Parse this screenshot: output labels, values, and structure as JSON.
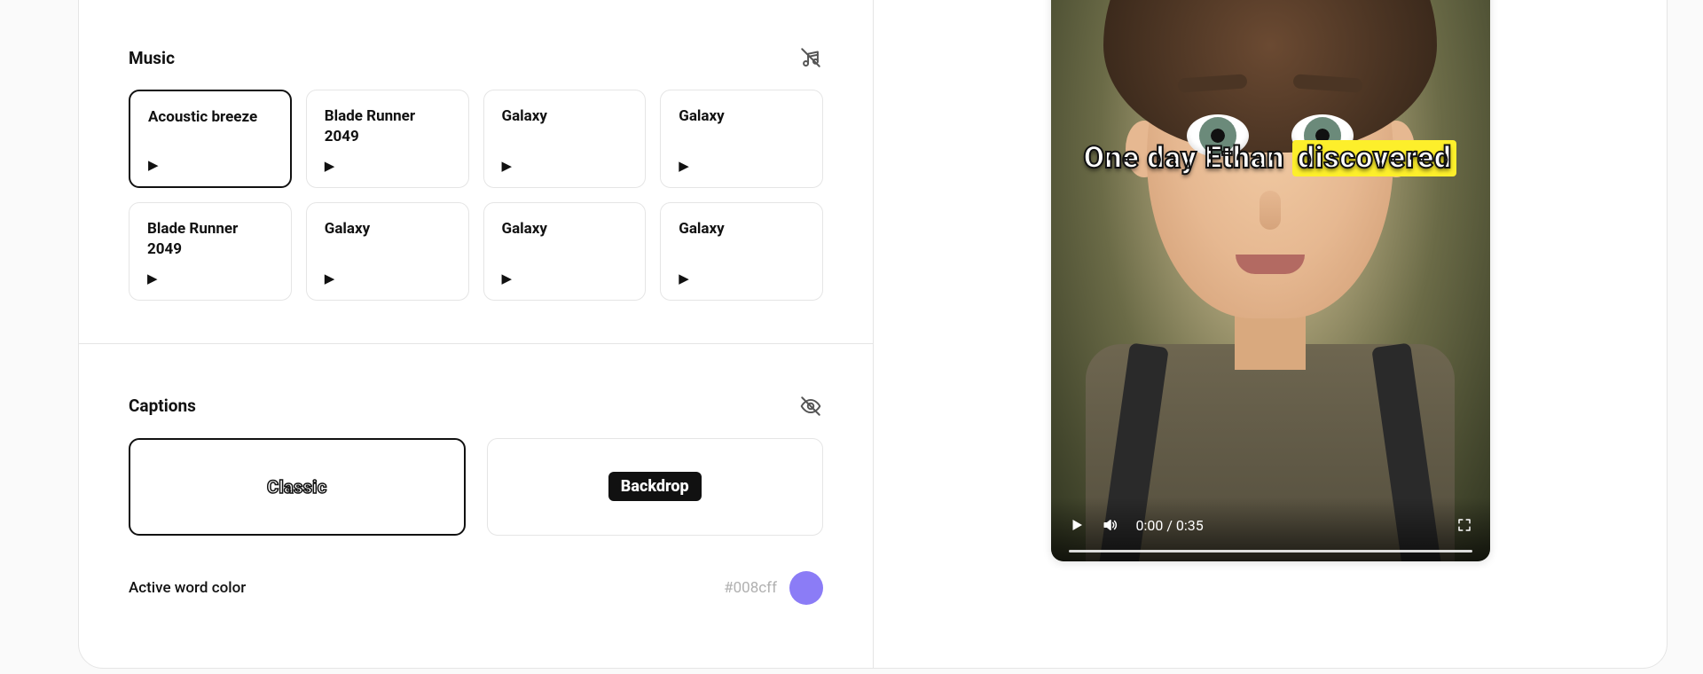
{
  "music": {
    "title": "Music",
    "tracks": [
      {
        "name": "Acoustic breeze",
        "selected": true
      },
      {
        "name": "Blade Runner 2049",
        "selected": false
      },
      {
        "name": "Galaxy",
        "selected": false
      },
      {
        "name": "Galaxy",
        "selected": false
      },
      {
        "name": "Blade Runner 2049",
        "selected": false
      },
      {
        "name": "Galaxy",
        "selected": false
      },
      {
        "name": "Galaxy",
        "selected": false
      },
      {
        "name": "Galaxy",
        "selected": false
      }
    ]
  },
  "captions": {
    "title": "Captions",
    "styles": [
      {
        "name": "Classic",
        "selected": true
      },
      {
        "name": "Backdrop",
        "selected": false
      }
    ],
    "active_word_color_label": "Active word color",
    "active_word_color_hex": "#008cff"
  },
  "preview": {
    "subtitle_plain": "One day Ethan",
    "subtitle_highlight": "discovered",
    "time_current": "0:00",
    "time_total": "0:35"
  }
}
